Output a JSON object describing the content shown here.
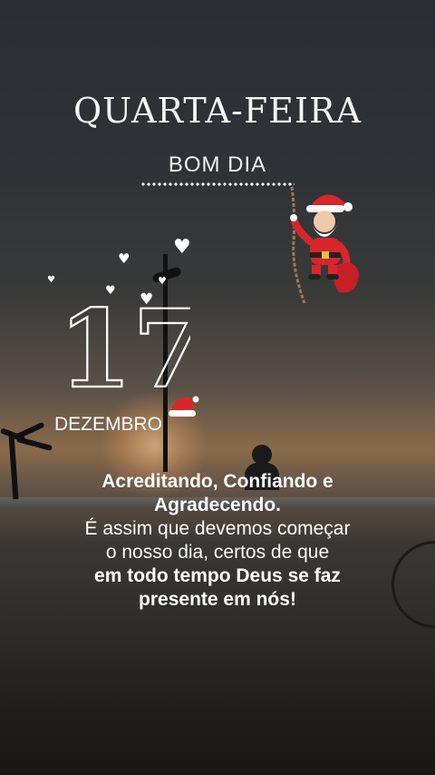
{
  "header": {
    "weekday": "QUARTA-FEIRA",
    "greeting": "BOM DIA"
  },
  "date": {
    "day": "17",
    "month": "DEZEMBRO"
  },
  "message": {
    "line1": "Acreditando, Confiando e",
    "line2": "Agradecendo.",
    "line3": "É assim que devemos começar",
    "line4": "o nosso dia, certos de que",
    "line5": "em todo tempo Deus se faz",
    "line6": "presente em nós!"
  },
  "decorations": {
    "heart_icon": "heart-icon",
    "santa_icon": "santa-claus-icon",
    "hat_icon": "santa-hat-icon"
  },
  "colors": {
    "text": "#ffffff",
    "santa_red": "#d9262b"
  }
}
